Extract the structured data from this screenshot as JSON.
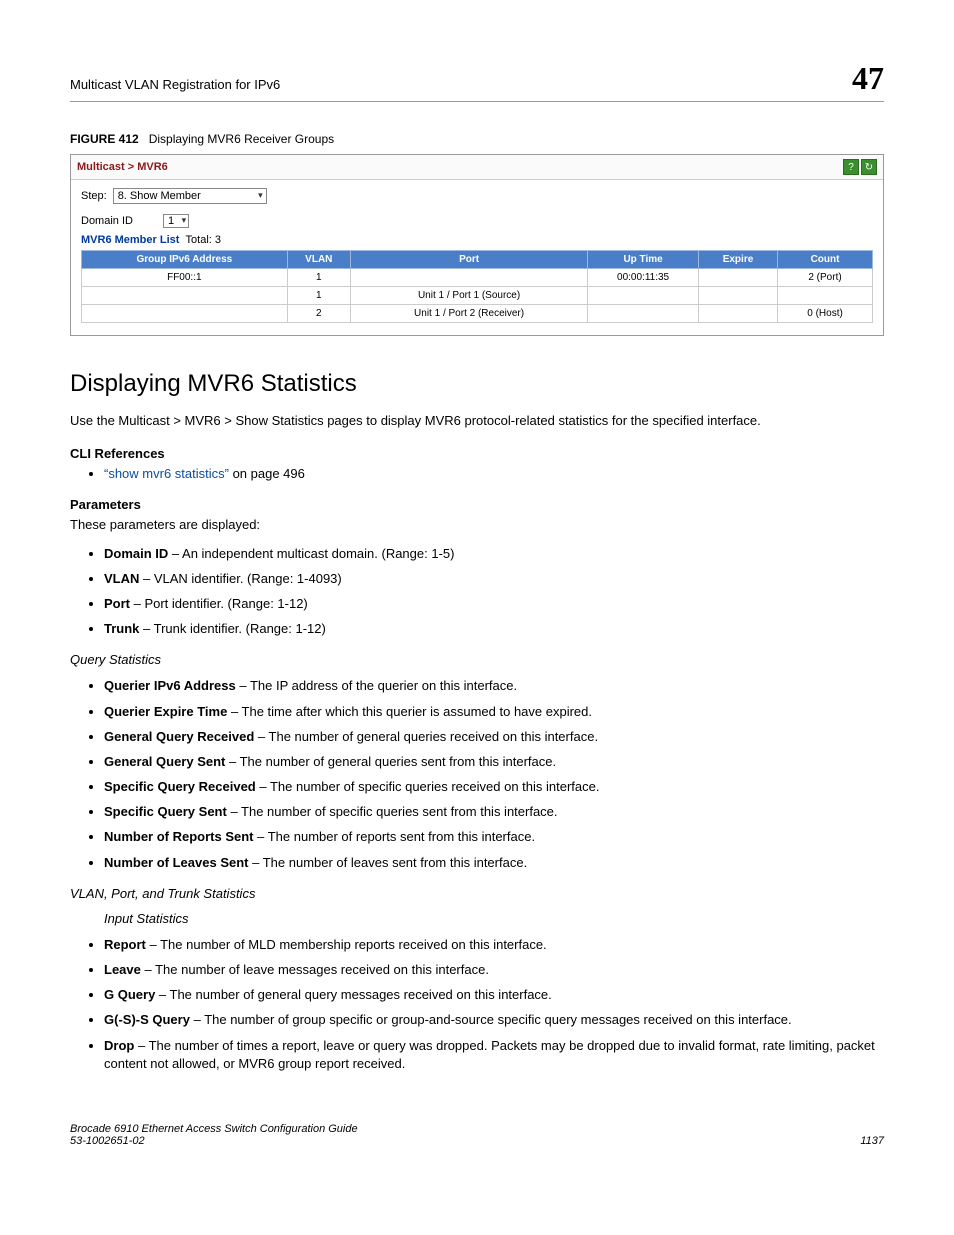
{
  "header": {
    "section": "Multicast VLAN Registration for IPv6",
    "chapter": "47"
  },
  "figure": {
    "label": "FIGURE 412",
    "caption": "Displaying MVR6 Receiver Groups",
    "breadcrumb": "Multicast > MVR6",
    "step_label": "Step:",
    "step_value": "8. Show Member",
    "domain_label": "Domain ID",
    "domain_value": "1",
    "list_title": "MVR6 Member List",
    "list_total_label": "Total: 3",
    "cols": {
      "group": "Group IPv6 Address",
      "vlan": "VLAN",
      "port": "Port",
      "uptime": "Up Time",
      "expire": "Expire",
      "count": "Count"
    },
    "rows": [
      {
        "group": "FF00::1",
        "vlan": "1",
        "port": "",
        "uptime": "00:00:11:35",
        "expire": "",
        "count": "2 (Port)"
      },
      {
        "group": "",
        "vlan": "1",
        "port": "Unit 1 / Port 1 (Source)",
        "uptime": "",
        "expire": "",
        "count": ""
      },
      {
        "group": "",
        "vlan": "2",
        "port": "Unit 1 / Port 2 (Receiver)",
        "uptime": "",
        "expire": "",
        "count": "0 (Host)"
      }
    ]
  },
  "section": {
    "title": "Displaying MVR6 Statistics",
    "intro": "Use the Multicast > MVR6 > Show Statistics pages to display MVR6 protocol-related statistics for the specified interface.",
    "cli_title": "CLI References",
    "cli_link": "“show mvr6 statistics”",
    "cli_link_suffix": " on page 496",
    "params_title": "Parameters",
    "params_intro": "These parameters are displayed:",
    "param_list1": [
      {
        "term": "Domain ID",
        "desc": " – An independent multicast domain. (Range: 1-5)"
      },
      {
        "term": "VLAN",
        "desc": " – VLAN identifier. (Range: 1-4093)"
      },
      {
        "term": "Port",
        "desc": " – Port identifier. (Range: 1-12)"
      },
      {
        "term": "Trunk",
        "desc": " – Trunk identifier. (Range: 1-12)"
      }
    ],
    "query_heading": "Query Statistics",
    "query_list": [
      {
        "term": "Querier IPv6 Address",
        "desc": " – The IP address of the querier on this interface."
      },
      {
        "term": "Querier Expire Time",
        "desc": " – The time after which this querier is assumed to have expired."
      },
      {
        "term": "General Query Received",
        "desc": " – The number of general queries received on this interface."
      },
      {
        "term": "General Query Sent",
        "desc": " – The number of general queries sent from this interface."
      },
      {
        "term": "Specific Query Received",
        "desc": " – The number of specific queries received on this interface."
      },
      {
        "term": "Specific Query Sent",
        "desc": " – The number of specific queries sent from this interface."
      },
      {
        "term": "Number of Reports Sent",
        "desc": " – The number of reports sent from this interface."
      },
      {
        "term": "Number of Leaves Sent",
        "desc": " – The number of leaves sent from this interface."
      }
    ],
    "vpt_heading": "VLAN, Port, and Trunk Statistics",
    "input_heading": "Input Statistics",
    "input_list": [
      {
        "term": "Report",
        "desc": " – The number of MLD membership reports received on this interface."
      },
      {
        "term": "Leave",
        "desc": " – The number of leave messages received on this interface."
      },
      {
        "term": "G Query",
        "desc": " – The number of general query messages received on this interface."
      },
      {
        "term": "G(-S)-S Query",
        "desc": " – The number of group specific or group-and-source specific query messages received on this interface."
      },
      {
        "term": "Drop",
        "desc": " – The number of times a report, leave or query was dropped. Packets may be dropped due to invalid format, rate limiting, packet content not allowed, or MVR6 group report received."
      }
    ]
  },
  "footer": {
    "line1": "Brocade 6910 Ethernet Access Switch Configuration Guide",
    "line2": "53-1002651-02",
    "page": "1137"
  }
}
